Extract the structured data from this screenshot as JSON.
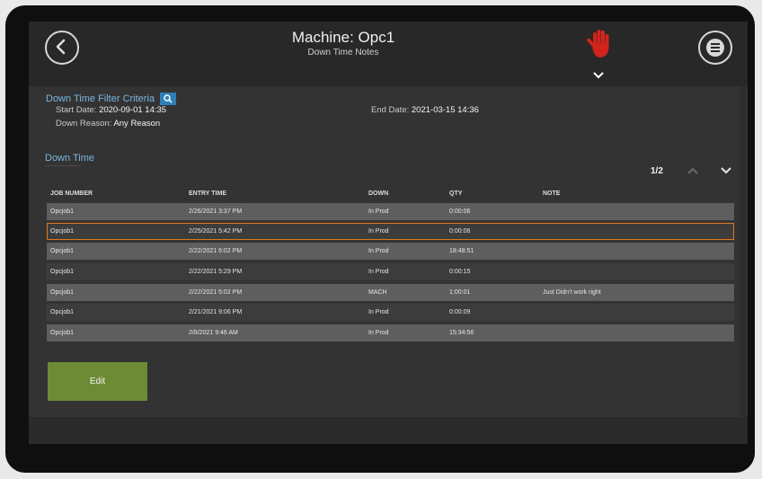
{
  "header": {
    "title": "Machine: Opc1",
    "subtitle": "Down Time Notes",
    "back_icon": "chevron-left-icon",
    "menu_icon": "menu-icon",
    "stop_icon": "hand-stop-icon",
    "stop_color": "#d0241c"
  },
  "filter": {
    "title": "Down Time Filter Criteria",
    "start_label": "Start Date:",
    "start_value": "2020-09-01 14:35",
    "end_label": "End Date:",
    "end_value": "2021-03-15 14:36",
    "reason_label": "Down Reason:",
    "reason_value": "Any Reason",
    "button_icon": "search-settings-icon"
  },
  "downtime": {
    "title": "Down Time",
    "pager": "1/2",
    "columns": [
      "JOB NUMBER",
      "ENTRY TIME",
      "DOWN",
      "QTY",
      "NOTE"
    ],
    "rows": [
      {
        "job": "Opcjob1",
        "entry": "2/26/2021 3:37 PM",
        "down": "In Prod",
        "qty": "0:00:06",
        "note": ""
      },
      {
        "job": "Opcjob1",
        "entry": "2/25/2021 5:42 PM",
        "down": "In Prod",
        "qty": "0:00:06",
        "note": ""
      },
      {
        "job": "Opcjob1",
        "entry": "2/22/2021 6:02 PM",
        "down": "In Prod",
        "qty": "18:48:51",
        "note": ""
      },
      {
        "job": "Opcjob1",
        "entry": "2/22/2021 5:29 PM",
        "down": "In Prod",
        "qty": "0:00:15",
        "note": ""
      },
      {
        "job": "Opcjob1",
        "entry": "2/22/2021 5:02 PM",
        "down": "MACH",
        "qty": "1:00:01",
        "note": "Just Didn't work right"
      },
      {
        "job": "Opcjob1",
        "entry": "2/21/2021 9:06 PM",
        "down": "In Prod",
        "qty": "0:00:09",
        "note": ""
      },
      {
        "job": "Opcjob1",
        "entry": "2/8/2021 9:46 AM",
        "down": "In Prod",
        "qty": "15:34:56",
        "note": ""
      }
    ],
    "selected_row": 1,
    "selected_color": "#e0761e"
  },
  "actions": {
    "edit_label": "Edit",
    "edit_color": "#6d8b35"
  }
}
